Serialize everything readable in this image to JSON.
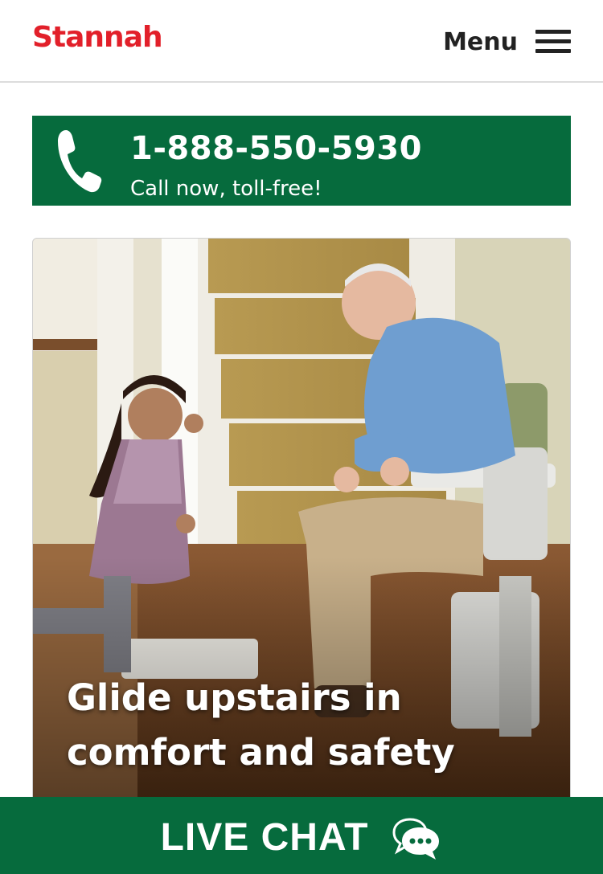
{
  "header": {
    "logo_text": "Stannah",
    "menu_label": "Menu",
    "brand_color": "#e2202a"
  },
  "phone_banner": {
    "number": "1-888-550-5930",
    "subtext": "Call now, toll-free!",
    "icon": "phone-icon",
    "background": "#066b3d"
  },
  "hero": {
    "caption_line1": "Glide upstairs in",
    "caption_line2": "comfort and safety",
    "image": "photo of an older man seated on a stairlift smiling at a young girl beside a carpeted staircase"
  },
  "live_chat": {
    "label": "LIVE CHAT",
    "icon": "chat-bubbles-icon",
    "background": "#066b3d"
  }
}
